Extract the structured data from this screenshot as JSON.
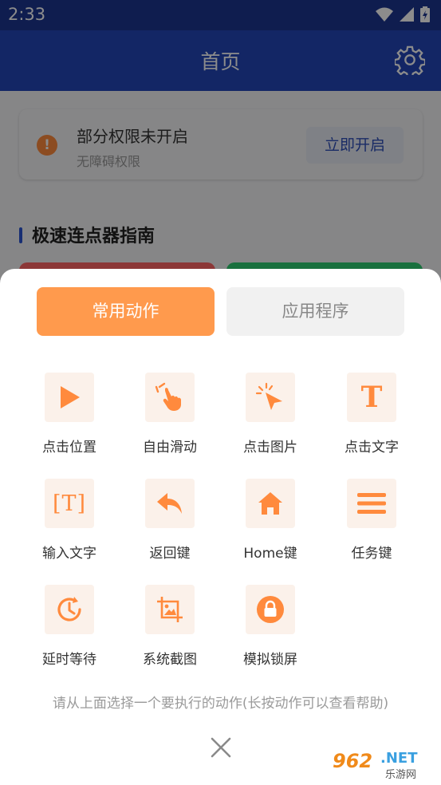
{
  "status_bar": {
    "time": "2:33"
  },
  "app_bar": {
    "title": "首页"
  },
  "permission_card": {
    "title": "部分权限未开启",
    "subtitle": "无障碍权限",
    "button": "立即开启",
    "warning_glyph": "!"
  },
  "guide": {
    "title": "极速连点器指南"
  },
  "sheet": {
    "tabs": [
      {
        "label": "常用动作",
        "active": true
      },
      {
        "label": "应用程序",
        "active": false
      }
    ],
    "actions": [
      {
        "label": "点击位置",
        "icon": "tap-position-icon"
      },
      {
        "label": "自由滑动",
        "icon": "swipe-hand-icon"
      },
      {
        "label": "点击图片",
        "icon": "tap-image-icon"
      },
      {
        "label": "点击文字",
        "icon": "text-t-icon",
        "glyph": "T"
      },
      {
        "label": "输入文字",
        "icon": "input-text-icon",
        "glyph": "[T]"
      },
      {
        "label": "返回键",
        "icon": "back-arrow-icon"
      },
      {
        "label": "Home键",
        "icon": "home-icon"
      },
      {
        "label": "任务键",
        "icon": "menu-lines-icon"
      },
      {
        "label": "延时等待",
        "icon": "clock-delay-icon"
      },
      {
        "label": "系统截图",
        "icon": "screenshot-crop-icon"
      },
      {
        "label": "模拟锁屏",
        "icon": "lock-icon"
      }
    ],
    "hint": "请从上面选择一个要执行的动作(长按动作可以查看帮助)"
  },
  "watermark": {
    "number": "962",
    "domain": ".NET",
    "site": "乐游网"
  },
  "colors": {
    "primary": "#2346b8",
    "accent": "#ff9a4d",
    "icon_bg": "#fbf1ea"
  }
}
